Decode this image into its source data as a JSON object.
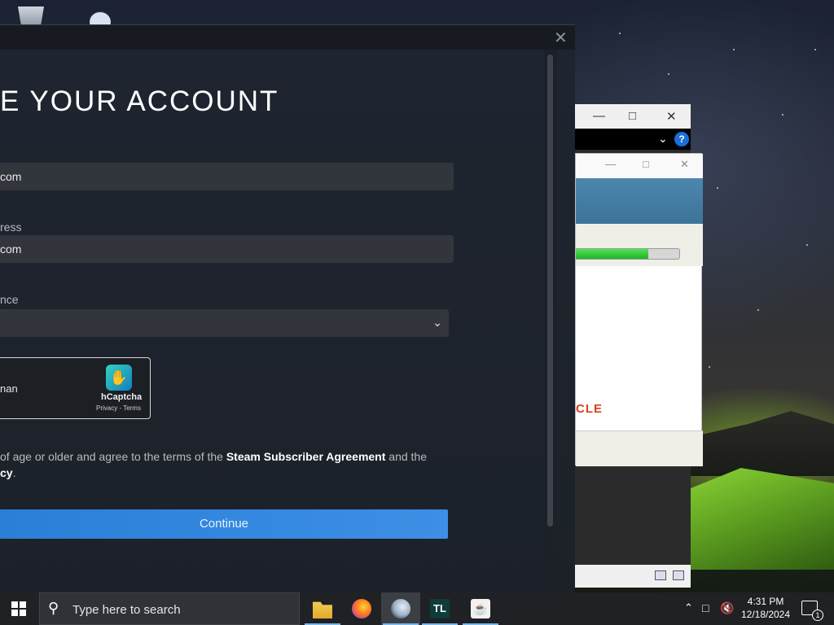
{
  "steam_window": {
    "heading": "E YOUR ACCOUNT",
    "email_value": "com",
    "confirm_label": "ress",
    "confirm_value": "com",
    "country_label": "nce",
    "captcha": {
      "checkbox_text": "nan",
      "brand": "hCaptcha",
      "links": "Privacy - Terms"
    },
    "agreement": {
      "prefix": "of age or older and agree to the terms of the ",
      "link": "Steam Subscriber Agreement",
      "suffix": " and the",
      "line2_link": "cy",
      "line2_suffix": "."
    },
    "continue_label": "Continue"
  },
  "installer": {
    "brand_text": "CLE",
    "progress_percent": 70
  },
  "taskbar": {
    "search_placeholder": "Type here to search",
    "time": "4:31 PM",
    "date": "12/18/2024",
    "notification_count": "1",
    "apps": [
      "file-explorer",
      "firefox",
      "steam",
      "tl-launcher",
      "java"
    ],
    "tl_label": "TL"
  }
}
